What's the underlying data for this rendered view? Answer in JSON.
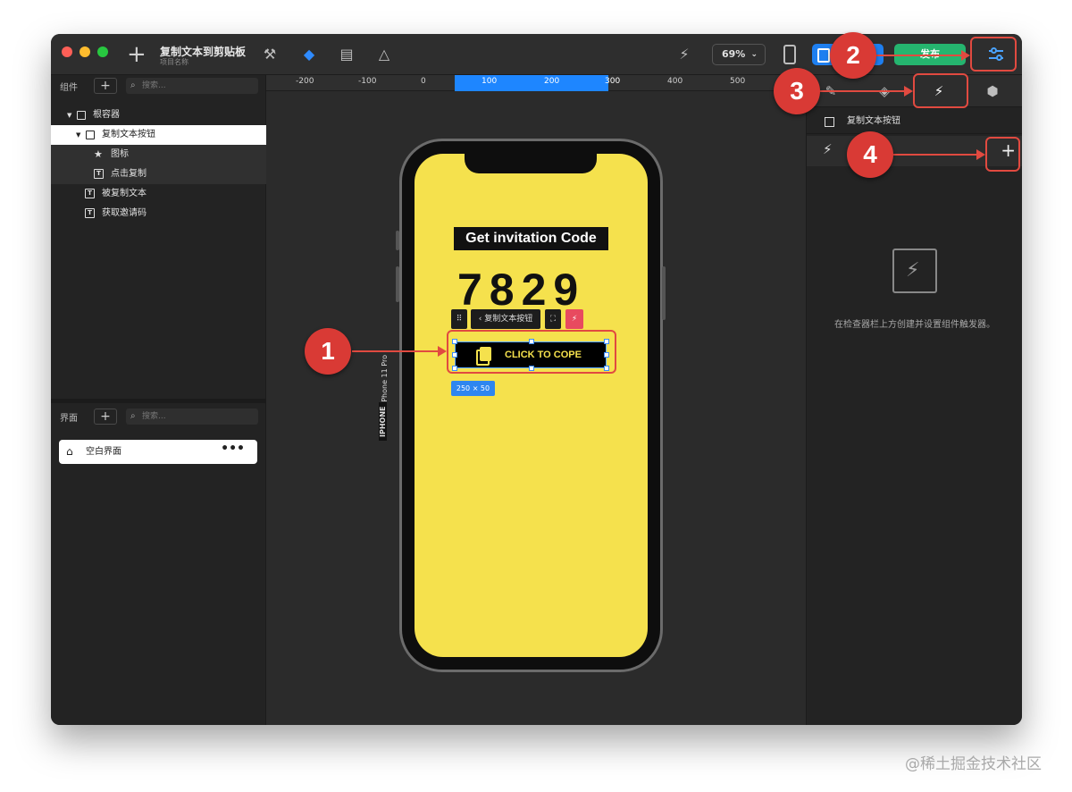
{
  "app": {
    "project_title": "复制文本到剪贴板",
    "project_subtitle": "项目名称",
    "zoom": "69%",
    "publish_label": "发布"
  },
  "components_panel": {
    "label": "组件",
    "search_placeholder": "搜索...",
    "tree": [
      {
        "label": "根容器"
      },
      {
        "label": "复制文本按钮"
      },
      {
        "label": "图标"
      },
      {
        "label": "点击复制"
      },
      {
        "label": "被复制文本"
      },
      {
        "label": "获取邀请码"
      }
    ]
  },
  "screens_panel": {
    "label": "界面",
    "search_placeholder": "搜索...",
    "items": [
      {
        "label": "空白界面",
        "more": "•••"
      }
    ]
  },
  "ruler": {
    "ticks": [
      "-200",
      "-100",
      "0",
      "100",
      "200",
      "300",
      "400",
      "500"
    ]
  },
  "canvas": {
    "invite_title": "Get invitation Code",
    "code": "7829",
    "mini_toolbar_label": "复制文本按钮",
    "button_label": "CLICK TO COPE",
    "size_badge": "250 × 50",
    "device_label": "iPhone 11 Pro",
    "device_type": "IPHONE"
  },
  "inspector": {
    "component_name": "复制文本按钮",
    "empty_message": "在检查器栏上方创建并设置组件触发器。"
  },
  "annotations": [
    "1",
    "2",
    "3",
    "4"
  ],
  "watermark": "@稀土掘金技术社区",
  "colors": {
    "accent_blue": "#1e86ff",
    "publish_green": "#25b56f",
    "annotation_red": "#d93a35",
    "screen_yellow": "#f5e14d"
  }
}
